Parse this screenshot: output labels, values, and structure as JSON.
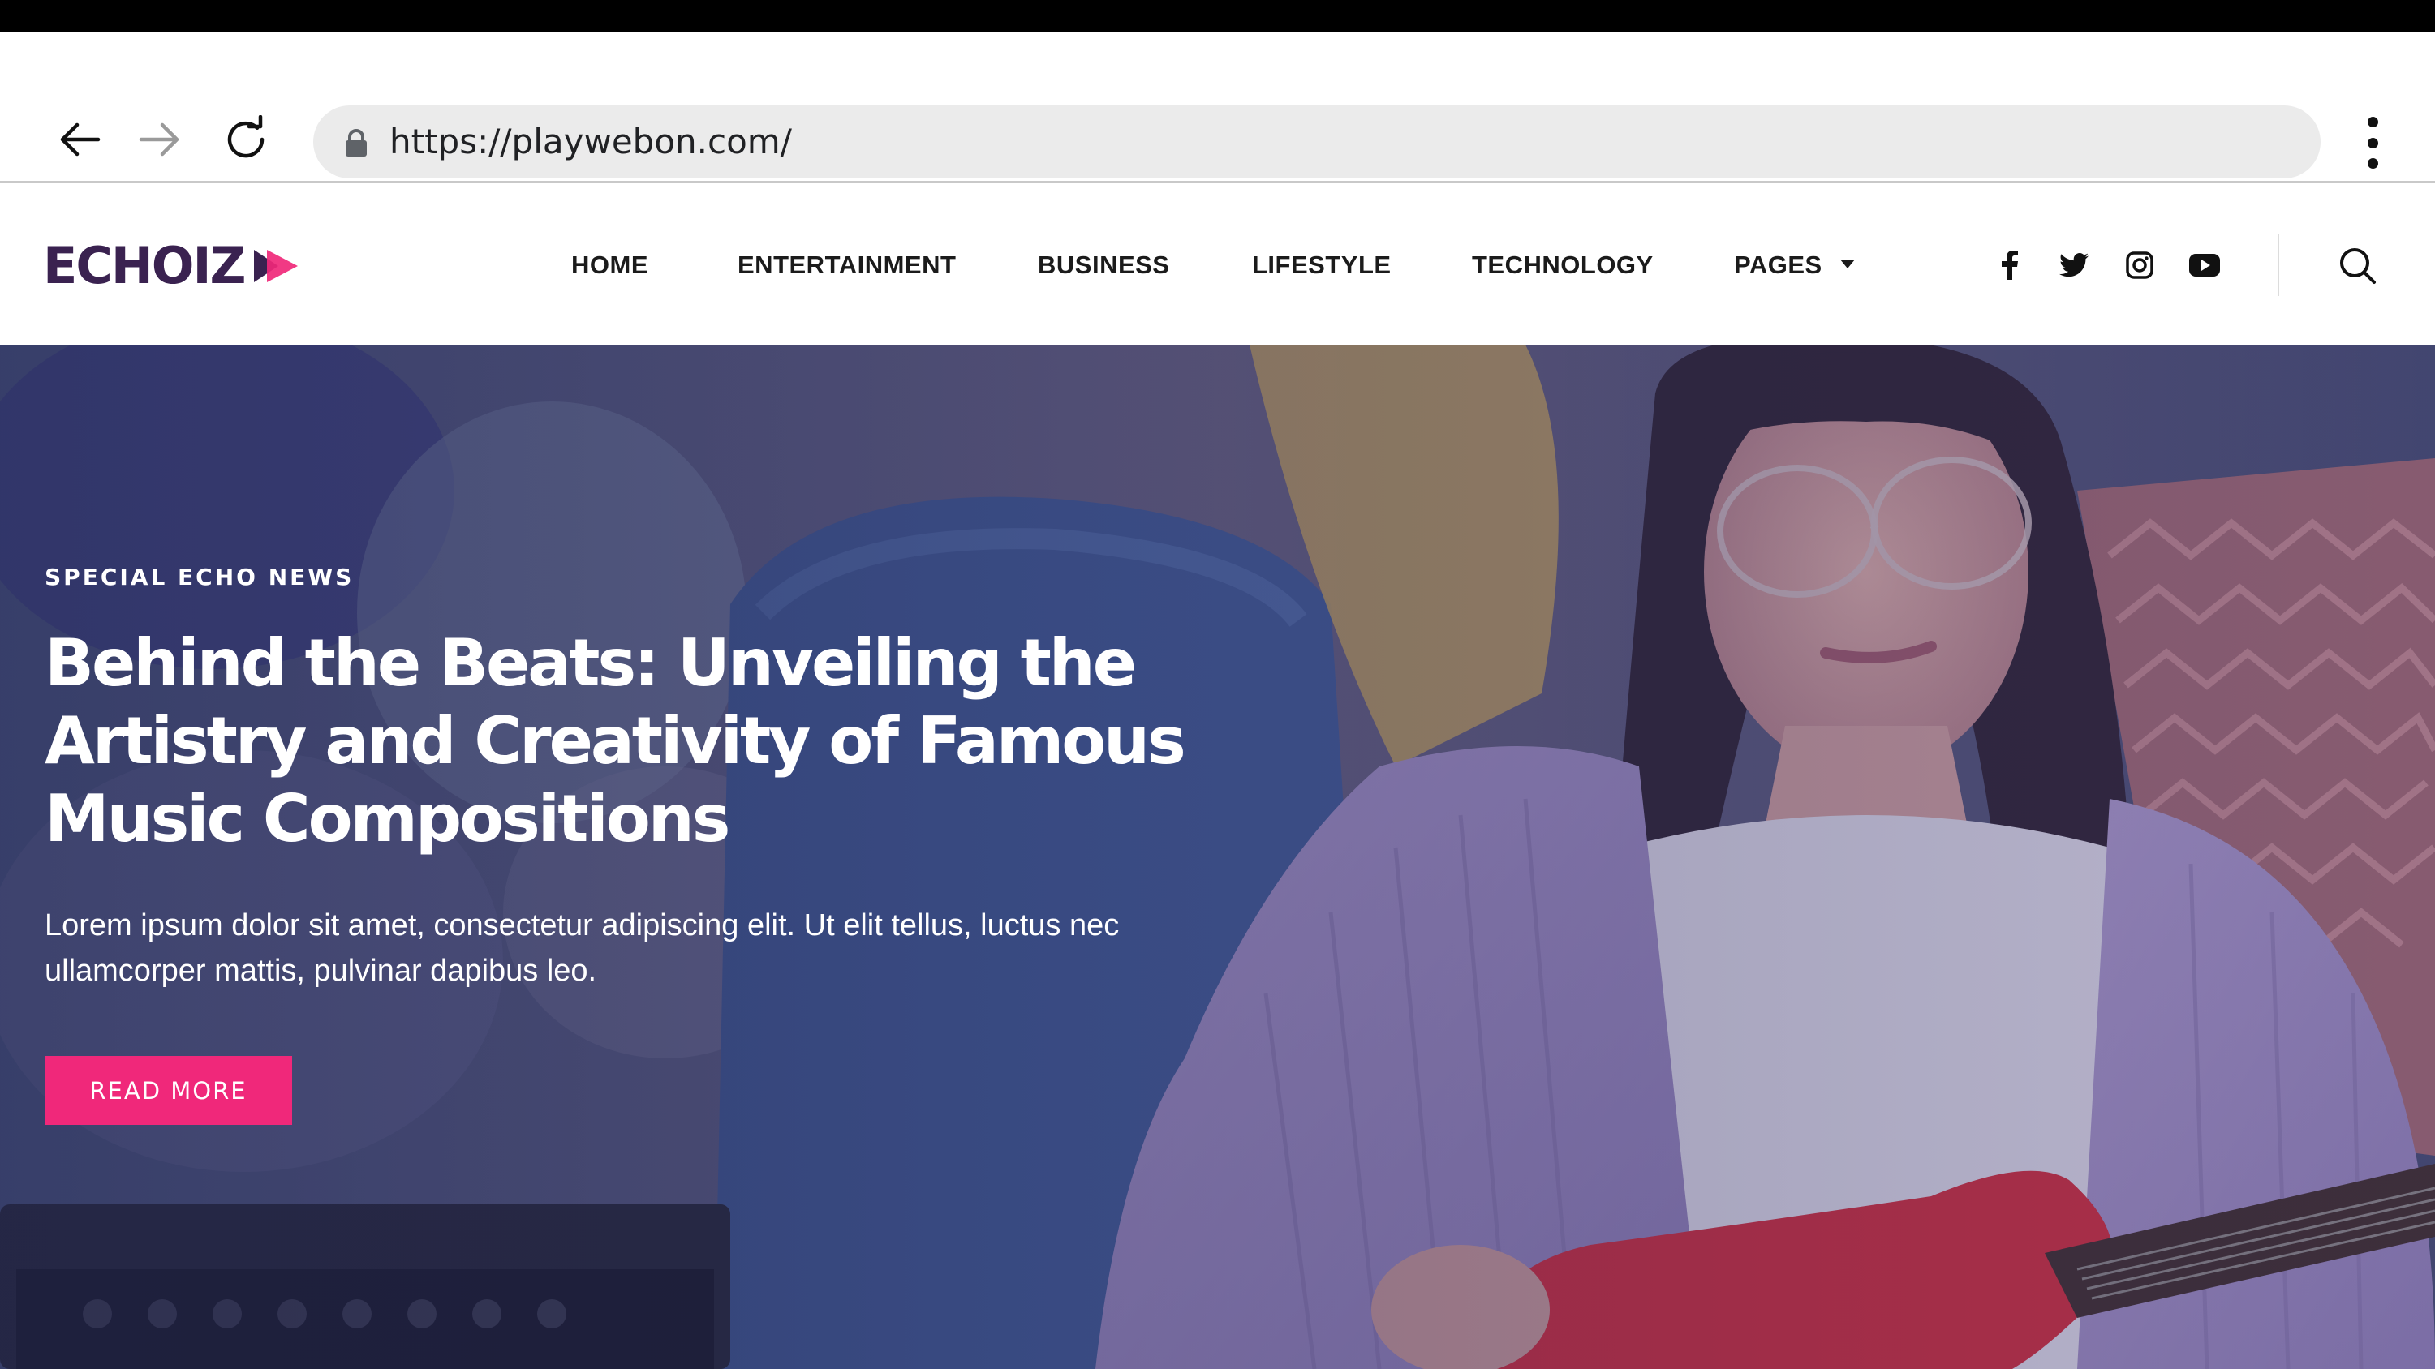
{
  "browser": {
    "url": "https://playwebon.com/",
    "back_icon": "arrow-left-icon",
    "forward_icon": "arrow-right-icon",
    "reload_icon": "reload-icon",
    "lock_icon": "lock-icon",
    "menu_icon": "kebab-menu-icon"
  },
  "site": {
    "logo_text": "ECHOIZ",
    "logo_mark": "play-triangle-icon",
    "nav": [
      {
        "label": "HOME"
      },
      {
        "label": "ENTERTAINMENT"
      },
      {
        "label": "BUSINESS"
      },
      {
        "label": "LIFESTYLE"
      },
      {
        "label": "TECHNOLOGY"
      },
      {
        "label": "PAGES",
        "has_dropdown": true
      }
    ],
    "social": [
      "facebook-icon",
      "twitter-icon",
      "instagram-icon",
      "youtube-icon"
    ],
    "search_icon": "search-icon"
  },
  "hero": {
    "eyebrow": "SPECIAL ECHO NEWS",
    "headline": "Behind the Beats: Unveiling the Artistry and Creativity of Famous Music Compositions",
    "excerpt": "Lorem ipsum dolor sit amet, consectetur adipiscing elit. Ut elit tellus, luctus nec ullamcorper mattis, pulvinar dapibus leo.",
    "cta_label": "READ MORE"
  },
  "colors": {
    "accent": "#f0287a",
    "logo": "#3a2250",
    "nav_text": "#1b1b1b",
    "hero_overlay": "#2e2e60"
  }
}
